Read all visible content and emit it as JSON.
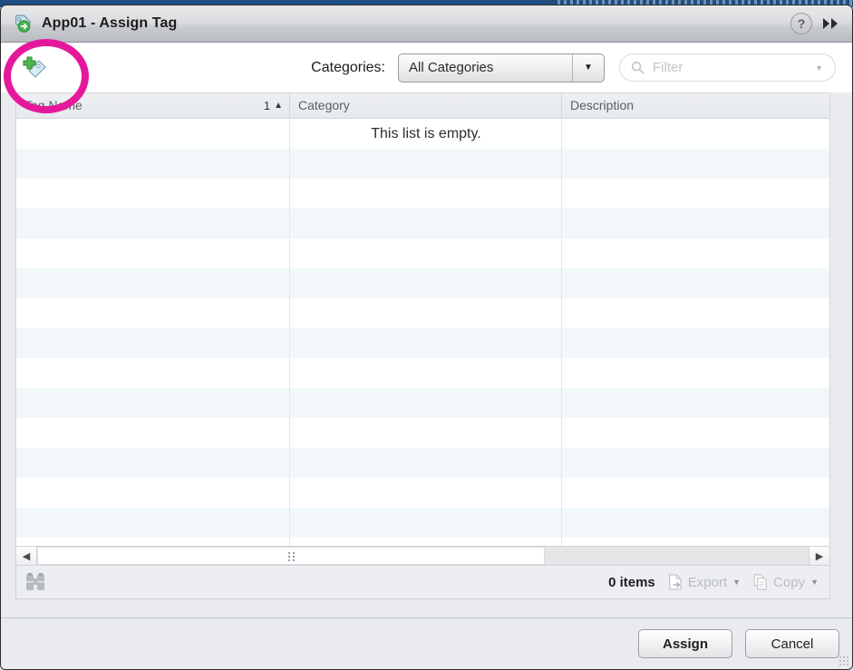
{
  "window": {
    "title": "App01 - Assign Tag",
    "title_icon": "tag-assign-icon",
    "help_icon": "help-question-icon",
    "help_label": "?",
    "expand_icon": "double-chevron-right-icon",
    "expand_label": "▶▶"
  },
  "toolbar": {
    "add_tag_icon": "add-tag-icon",
    "categories_label": "Categories:",
    "categories_value": "All Categories",
    "categories_arrow": "▼",
    "filter_icon": "search-magnifier-icon",
    "filter_placeholder": "Filter",
    "filter_value": "",
    "filter_caret": "▼"
  },
  "table": {
    "columns": [
      {
        "label": "Tag Name",
        "sort_index": "1",
        "sort_arrow": "▲"
      },
      {
        "label": "Category"
      },
      {
        "label": "Description"
      }
    ],
    "empty_message": "This list is empty.",
    "rows": []
  },
  "scrollbar": {
    "left_arrow": "◀",
    "right_arrow": "▶",
    "grip_icon": "scroll-grip-icon"
  },
  "statusbar": {
    "find_icon": "binoculars-icon",
    "items_count": "0 items",
    "export_label": "Export",
    "export_icon": "export-document-icon",
    "export_caret": "▼",
    "copy_label": "Copy",
    "copy_icon": "copy-document-icon",
    "copy_caret": "▼"
  },
  "footer": {
    "assign_label": "Assign",
    "cancel_label": "Cancel"
  },
  "annotation": {
    "shape": "ellipse-highlight",
    "color": "#e5189b"
  }
}
